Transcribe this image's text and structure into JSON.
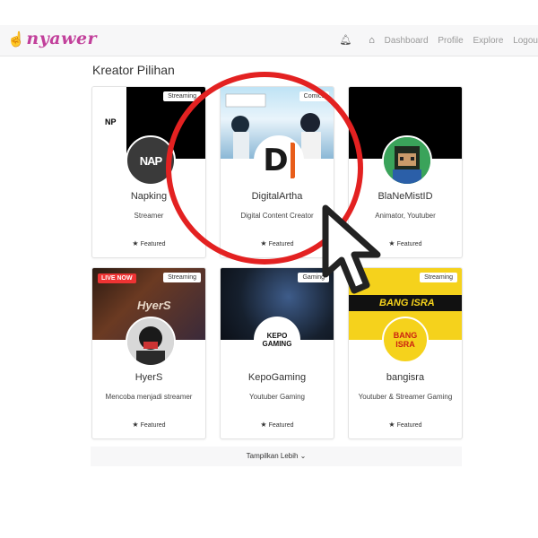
{
  "app": {
    "logo_text": "nyawer"
  },
  "nav": {
    "dashboard": "Dashboard",
    "profile": "Profile",
    "explore": "Explore",
    "logout": "Logou"
  },
  "section": {
    "title": "Kreator Pilihan"
  },
  "cards": [
    {
      "tag": "Streaming",
      "name": "Napking",
      "desc": "Streamer",
      "featured": "Featured",
      "avatar_text": "NAP",
      "banner_text": "NP"
    },
    {
      "tag": "Comics",
      "name": "DigitalArtha",
      "desc": "Digital Content Creator",
      "featured": "Featured",
      "avatar_text": "D"
    },
    {
      "tag": "",
      "name": "BlaNeMistID",
      "desc": "Animator, Youtuber",
      "featured": "Featured"
    },
    {
      "tag": "Streaming",
      "live": "LIVE NOW",
      "name": "HyerS",
      "desc": "Mencoba menjadi streamer",
      "featured": "Featured",
      "banner_text": "HyerS"
    },
    {
      "tag": "Gaming",
      "name": "KepoGaming",
      "desc": "Youtuber Gaming",
      "featured": "Featured",
      "avatar_text": "KEPO GAMING"
    },
    {
      "tag": "Streaming",
      "name": "bangisra",
      "desc": "Youtuber & Streamer Gaming",
      "featured": "Featured",
      "avatar_text": "BANG ISRA",
      "banner_text": "BANG ISRA"
    }
  ],
  "show_more": {
    "label": "Tampilkan Lebih"
  },
  "colors": {
    "brand": "#c2409b",
    "highlight": "#e32121"
  }
}
